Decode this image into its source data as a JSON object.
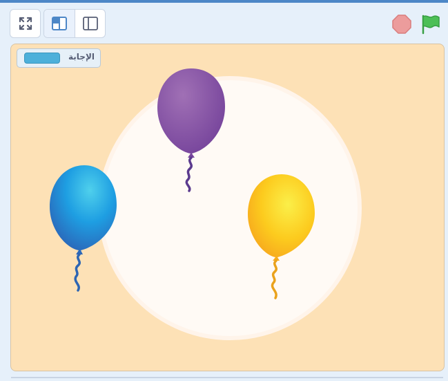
{
  "toolbar": {
    "fullscreen_icon": "fullscreen-icon",
    "small_stage_icon": "small-stage-layout-icon",
    "normal_stage_icon": "normal-stage-layout-icon",
    "stop_icon": "stop-icon",
    "green_flag_icon": "green-flag-icon"
  },
  "stage": {
    "backdrop_color": "#fde1b6",
    "plate_color": "#fffaf5",
    "monitor": {
      "label": "الإجابة",
      "value": ""
    },
    "sprites": [
      {
        "name": "purple-balloon",
        "color": "#8e57a9"
      },
      {
        "name": "blue-balloon",
        "color": "#1e90d8"
      },
      {
        "name": "yellow-balloon",
        "color": "#fcc21c"
      }
    ]
  },
  "colors": {
    "accent": "#4d87c7",
    "stop": "#ec9c9c",
    "flag": "#4cbf56"
  }
}
